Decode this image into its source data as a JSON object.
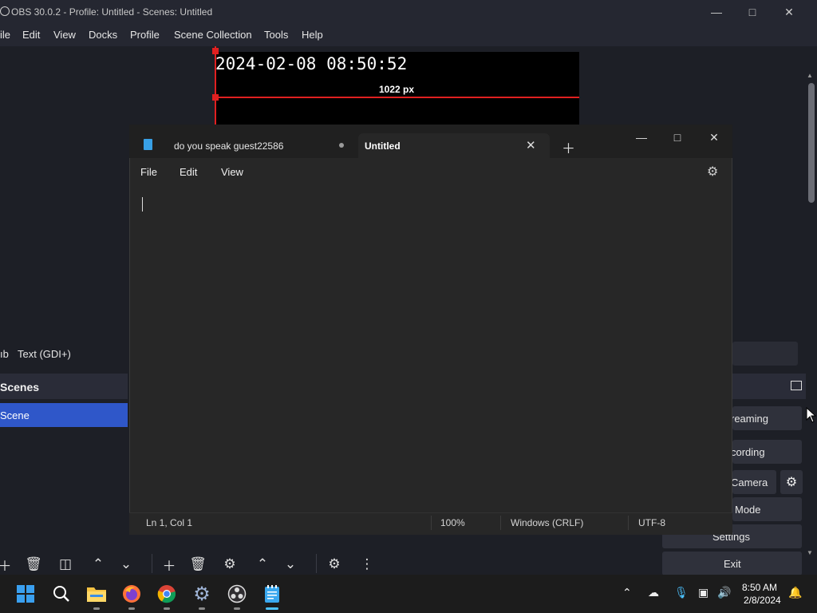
{
  "obs": {
    "title": "OBS 30.0.2 - Profile: Untitled - Scenes: Untitled",
    "menu": [
      "ile",
      "Edit",
      "View",
      "Docks",
      "Profile",
      "Scene Collection",
      "Tools",
      "Help"
    ],
    "preview": {
      "clock": "2024-02-08 08:50:52",
      "width_label": "1022 px"
    },
    "source_label_partial": "ıb",
    "source_name": "Text (GDI+)",
    "scenes_title": "Scenes",
    "scene_item": "Scene",
    "controls": {
      "streaming": "reaming",
      "recording": "cording",
      "camera": "Camera",
      "mode": "Mode",
      "settings": "Settings",
      "exit": "Exit"
    }
  },
  "notepad": {
    "tabs": [
      {
        "label": "do you speak guest22586",
        "unsaved": true
      },
      {
        "label": "Untitled",
        "active": true
      }
    ],
    "menu": [
      "File",
      "Edit",
      "View"
    ],
    "status": {
      "position": "Ln 1, Col 1",
      "zoom": "100%",
      "line_ending": "Windows (CRLF)",
      "encoding": "UTF-8"
    }
  },
  "taskbar": {
    "time": "8:50 AM",
    "date": "2/8/2024"
  },
  "colors": {
    "obs_bg": "#1d1f26",
    "scene_selected": "#2f57c9",
    "preview_guide": "#e02020",
    "notepad_bg": "#272727",
    "taskbar_bg": "#1c1c1c"
  }
}
